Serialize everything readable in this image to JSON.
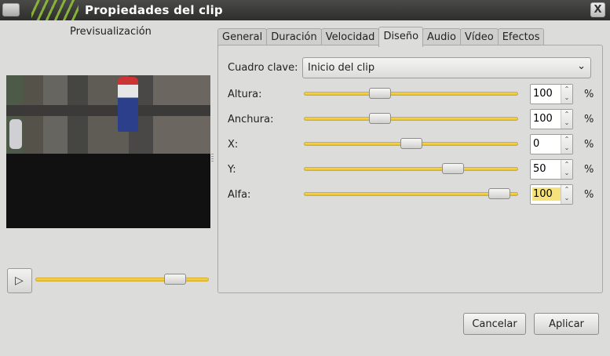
{
  "window": {
    "title": "Propiedades del clip",
    "close_label": "X"
  },
  "preview": {
    "label": "Previsualización",
    "play_icon": "▷",
    "position": 0.85
  },
  "tabs": [
    {
      "label": "General",
      "active": false
    },
    {
      "label": "Duración",
      "active": false
    },
    {
      "label": "Velocidad",
      "active": false
    },
    {
      "label": "Diseño",
      "active": true
    },
    {
      "label": "Audio",
      "active": false
    },
    {
      "label": "Vídeo",
      "active": false
    },
    {
      "label": "Efectos",
      "active": false
    }
  ],
  "layout": {
    "keyframe": {
      "label": "Cuadro clave:",
      "value": "Inicio del clip"
    },
    "fields": [
      {
        "label": "Altura:",
        "value": "100",
        "unit": "%",
        "slider": 0.34
      },
      {
        "label": "Anchura:",
        "value": "100",
        "unit": "%",
        "slider": 0.34
      },
      {
        "label": "X:",
        "value": "0",
        "unit": "%",
        "slider": 0.5
      },
      {
        "label": "Y:",
        "value": "50",
        "unit": "%",
        "slider": 0.72
      },
      {
        "label": "Alfa:",
        "value": "100",
        "unit": "%",
        "slider": 0.96
      }
    ]
  },
  "buttons": {
    "cancel": "Cancelar",
    "apply": "Aplicar"
  },
  "colors": {
    "slider_fill": "#e8be2a",
    "titlebar_accent": "#8fbf3a"
  }
}
